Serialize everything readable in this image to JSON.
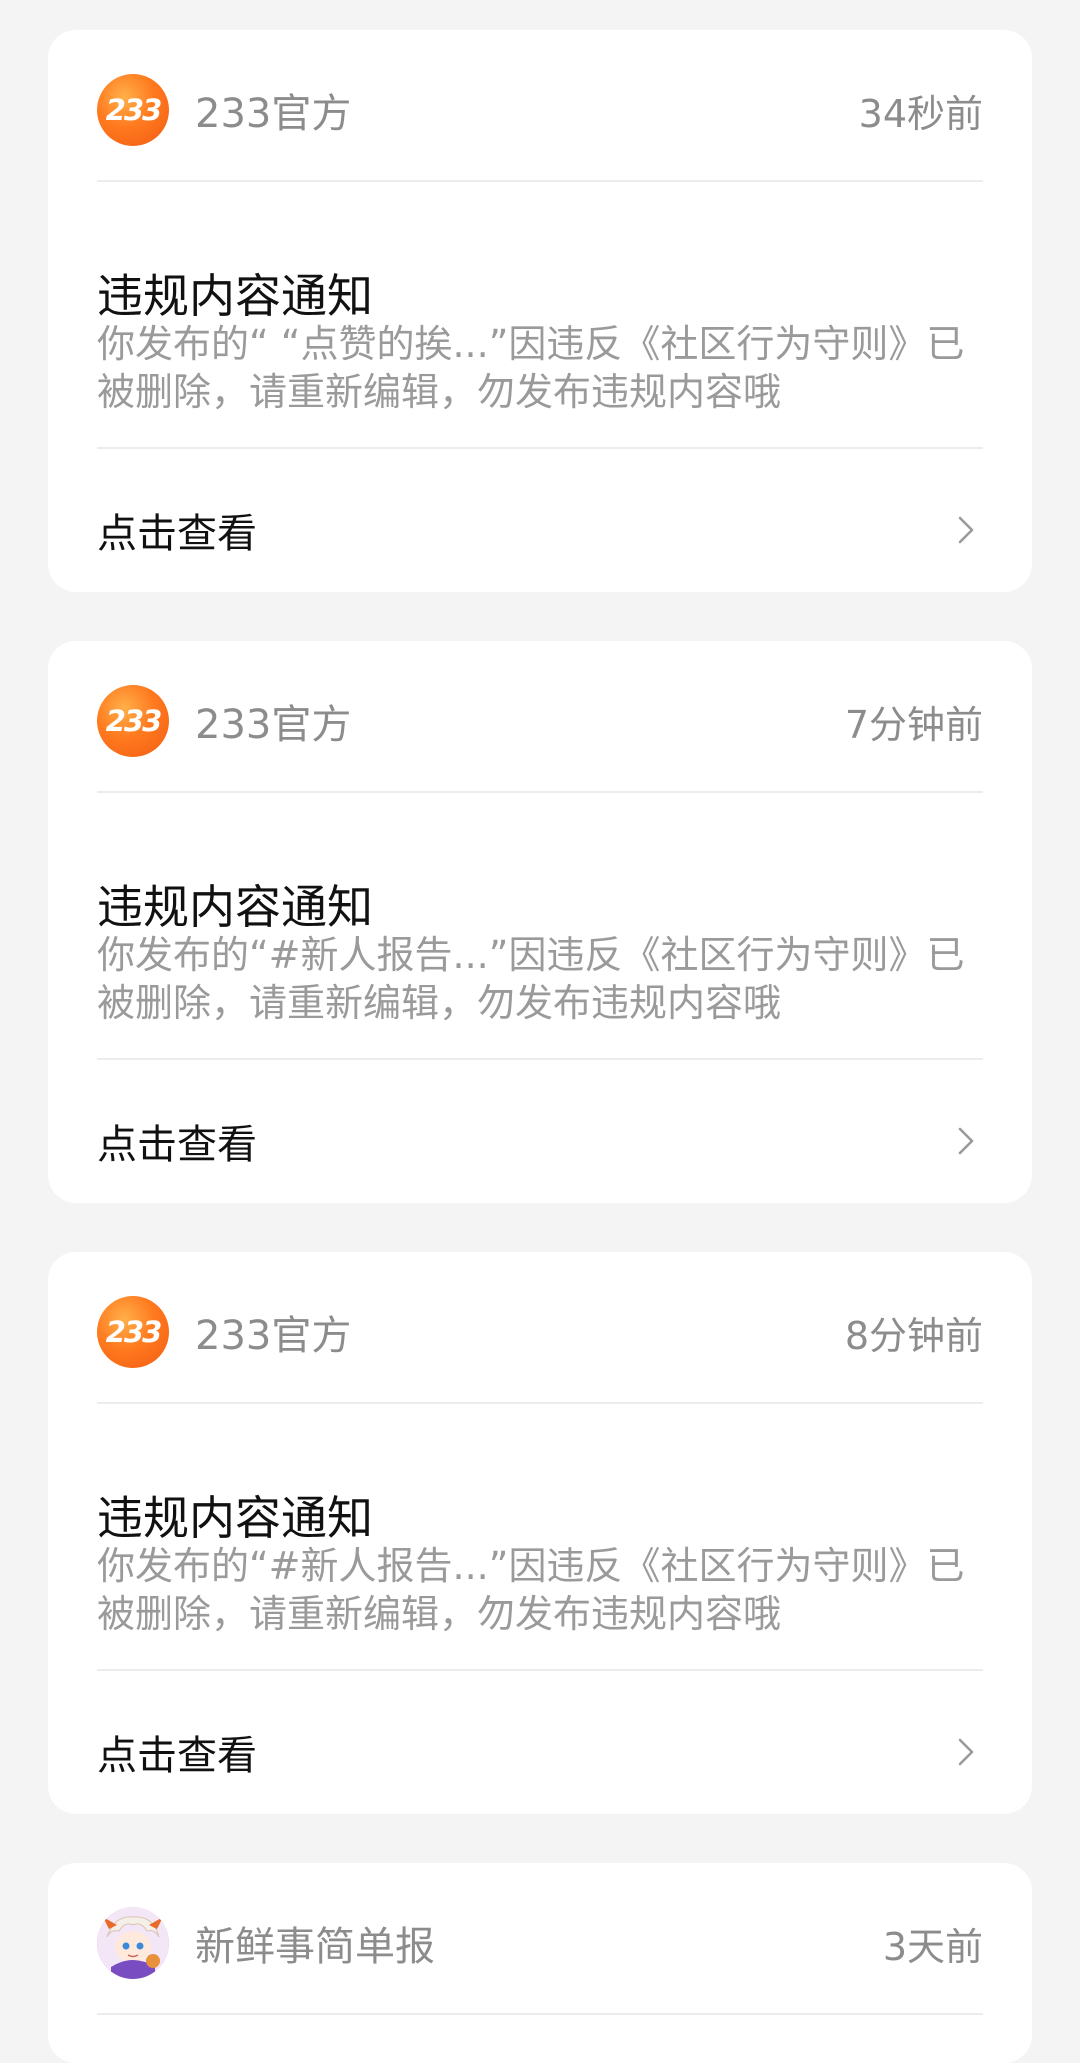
{
  "notifications": [
    {
      "source": "233官方",
      "avatar": "brand-233-logo",
      "avatar_text": "233",
      "time": "34秒前",
      "title": "违规内容通知",
      "body": "你发布的“ “点赞的挨...”因违反《社区行为守则》已被删除，请重新编辑，勿发布违规内容哦",
      "action": "点击查看"
    },
    {
      "source": "233官方",
      "avatar": "brand-233-logo",
      "avatar_text": "233",
      "time": "7分钟前",
      "title": "违规内容通知",
      "body": "你发布的“#新人报告...”因违反《社区行为守则》已被删除，请重新编辑，勿发布违规内容哦",
      "action": "点击查看"
    },
    {
      "source": "233官方",
      "avatar": "brand-233-logo",
      "avatar_text": "233",
      "time": "8分钟前",
      "title": "违规内容通知",
      "body": "你发布的“#新人报告...”因违反《社区行为守则》已被删除，请重新编辑，勿发布违规内容哦",
      "action": "点击查看"
    },
    {
      "source": "新鲜事简单报",
      "avatar": "illustrated-character-avatar",
      "time": "3天前"
    }
  ],
  "colors": {
    "page_bg": "#f4f4f4",
    "card_bg": "#ffffff",
    "brand_orange": "#ff7a1f",
    "muted_text": "#8c8c8c",
    "title_text": "#111111"
  },
  "icons": {
    "chevron": "chevron-right-icon"
  }
}
